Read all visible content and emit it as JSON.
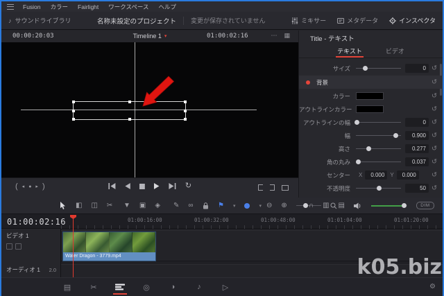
{
  "colors": {
    "accent_red": "#e5453a",
    "window_border_blue": "#2a7bdf",
    "flag_blue": "#4a7fe8",
    "clip_bar_blue": "#628fc2",
    "playhead_red": "#e13a2f",
    "volume_green": "#43a047",
    "color_swatch": "#000000",
    "outline_color_swatch": "#000000"
  },
  "menubar": {
    "items": [
      "Fusion",
      "カラー",
      "Fairlight",
      "ワークスペース",
      "ヘルプ"
    ]
  },
  "topbar": {
    "sound_library": "サウンドライブラリ",
    "project_title": "名称未設定のプロジェクト",
    "save_status": "変更が保存されていません",
    "mixer": "ミキサー",
    "metadata": "メタデータ",
    "inspector": "インスペクタ"
  },
  "viewer": {
    "source_timecode": "00:00:20:03",
    "timeline_name": "Timeline 1",
    "record_timecode": "01:00:02:16"
  },
  "inspector": {
    "title": "Title - テキスト",
    "tab_text": "テキスト",
    "tab_video": "ビデオ",
    "rows": {
      "size": {
        "label": "サイズ",
        "value": "0",
        "pct": 20
      },
      "background": {
        "label": "背景"
      },
      "color": {
        "label": "カラー"
      },
      "outline_color": {
        "label": "アウトラインカラー"
      },
      "outline_width": {
        "label": "アウトラインの幅",
        "value": "0",
        "pct": 2
      },
      "width": {
        "label": "幅",
        "value": "0.900",
        "pct": 88
      },
      "height": {
        "label": "高さ",
        "value": "0.277",
        "pct": 28
      },
      "corner_radius": {
        "label": "角の丸み",
        "value": "0.037",
        "pct": 5
      },
      "center": {
        "label": "センター",
        "x_label": "X",
        "x_value": "0.000",
        "y_label": "Y",
        "y_value": "0.000"
      },
      "opacity": {
        "label": "不透明度",
        "value": "50",
        "pct": 50
      }
    }
  },
  "toolbar": {
    "zoom_pct": 38,
    "volume_pct": 90,
    "dim_label": "DIM"
  },
  "timeline": {
    "playhead_timecode": "01:00:02:16",
    "ruler_labels": [
      "01:00:16:00",
      "01:00:32:00",
      "01:00:48:00",
      "01:01:04:00",
      "01:01:20:00"
    ],
    "video_track": "ビデオ 1",
    "audio_track": "オーディオ 1",
    "audio_channels": "2.0",
    "clip_name": "Water Dragon - 3779.mp4"
  },
  "watermark": "k05.biz",
  "icons": {
    "viewer_more": "⋯",
    "viewer_grid": "▦",
    "caret_down": "▾",
    "loop": "↻",
    "jog_left": "◂",
    "jog_dot": "●",
    "jog_right": "▸",
    "paren_l": "(",
    "paren_r": ")",
    "tool_trim": "◧",
    "tool_dynamic": "◫",
    "tool_razor": "✂",
    "tool_insert": "▼",
    "tool_overwrite": "▣",
    "tool_replace": "◈",
    "tool_pen": "✎",
    "tool_link": "∞",
    "flag": "⚑",
    "zoom_out": "⊖",
    "zoom_in": "⊕",
    "snap": "∩",
    "view_opt_a": "▥",
    "view_opt_b": "▤",
    "page_media": "▤",
    "page_cut": "✂",
    "page_fusion": "◎",
    "page_color": "◑",
    "page_fairlight": "♪",
    "page_deliver": "▷",
    "gear": "⚙",
    "note": "♪",
    "reset": "↺"
  }
}
